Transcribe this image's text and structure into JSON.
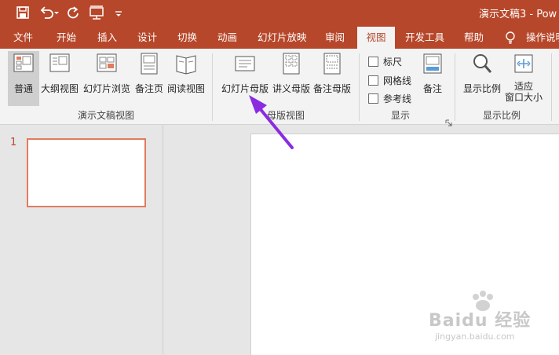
{
  "window": {
    "title": "演示文稿3  -  Pow"
  },
  "quick_access": [
    {
      "icon": "save-icon"
    },
    {
      "icon": "undo-icon"
    },
    {
      "icon": "redo-icon"
    },
    {
      "icon": "present-icon"
    },
    {
      "icon": "customize-icon"
    }
  ],
  "tabs": [
    "文件",
    "开始",
    "插入",
    "设计",
    "切换",
    "动画",
    "幻灯片放映",
    "审阅",
    "视图",
    "开发工具",
    "帮助",
    "操作说明"
  ],
  "active_tab": "视图",
  "ribbon": {
    "groups": {
      "presentation_views": {
        "label": "演示文稿视图",
        "buttons": [
          "普通",
          "大纲视图",
          "幻灯片浏览",
          "备注页",
          "阅读视图"
        ]
      },
      "master_views": {
        "label": "母版视图",
        "buttons": [
          "幻灯片母版",
          "讲义母版",
          "备注母版"
        ]
      },
      "show": {
        "label": "显示",
        "checkboxes": [
          "标尺",
          "网格线",
          "参考线"
        ],
        "notes_button": "备注"
      },
      "zoom": {
        "label": "显示比例",
        "buttons": [
          "显示比例",
          "适应\n窗口大小"
        ],
        "fit_line1": "适应",
        "fit_line2": "窗口大小"
      }
    }
  },
  "slides_pane": {
    "slide_number": "1"
  },
  "colors": {
    "accent": "#b7472a",
    "annotation_arrow": "#8a2be2",
    "thumb_border": "#e07b5f"
  },
  "watermark": {
    "line1": "Baidu 经验",
    "line2": "jingyan.baidu.com"
  }
}
